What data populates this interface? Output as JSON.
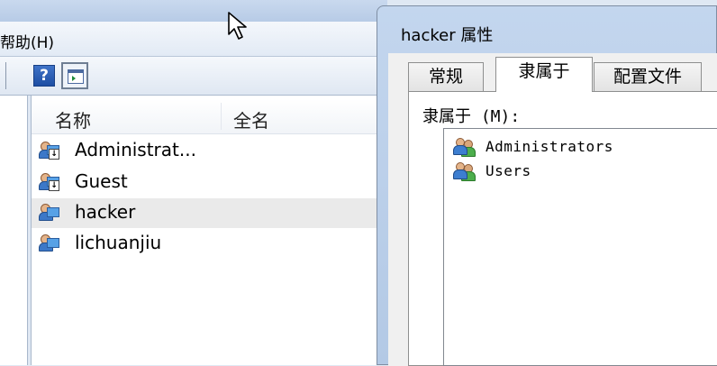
{
  "background_window": {
    "menu": {
      "help_label": "帮助(H)"
    },
    "toolbar": {
      "help_button_glyph": "?",
      "view_button_icon": "show-hide-action-pane-icon"
    },
    "list": {
      "columns": [
        "名称",
        "全名"
      ],
      "users": [
        {
          "name": "Administrat...",
          "full_name": "",
          "icon": "disabled-user-icon"
        },
        {
          "name": "Guest",
          "full_name": "",
          "icon": "disabled-user-icon"
        },
        {
          "name": "hacker",
          "full_name": "",
          "icon": "user-icon",
          "selected": true
        },
        {
          "name": "lichuanjiu",
          "full_name": "",
          "icon": "user-icon"
        }
      ]
    }
  },
  "dialog": {
    "title": "hacker 属性",
    "tabs": [
      {
        "label": "常规",
        "active": false
      },
      {
        "label": "隶属于",
        "active": true
      },
      {
        "label": "配置文件",
        "active": false
      }
    ],
    "member_of_label": "隶属于 (M):",
    "groups": [
      {
        "name": "Administrators",
        "icon": "group-icon"
      },
      {
        "name": "Users",
        "icon": "group-icon"
      }
    ]
  },
  "colors": {
    "selection": "#eaeaea",
    "dialog_frame": "#b3c9e5",
    "accent_blue": "#3d7ed0"
  }
}
